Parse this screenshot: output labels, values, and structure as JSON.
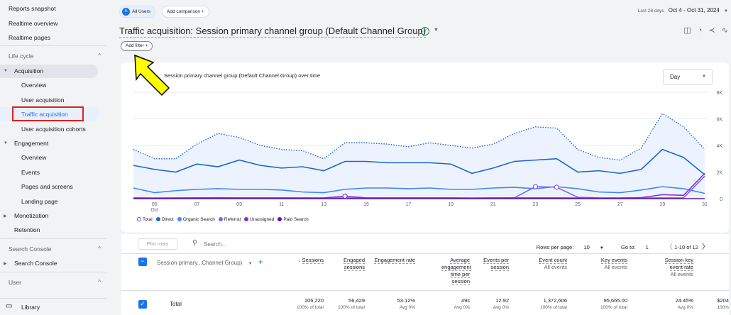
{
  "sidebar": {
    "items": [
      {
        "label": "Reports snapshot"
      },
      {
        "label": "Realtime overview"
      },
      {
        "label": "Realtime pages"
      }
    ],
    "lifecycle": {
      "label": "Life cycle",
      "acquisition": "Acquisition",
      "acquisition_items": [
        "Overview",
        "User acquisition",
        "Traffic acquisition",
        "User acquisition cohorts"
      ],
      "engagement": "Engagement",
      "engagement_items": [
        "Overview",
        "Events",
        "Pages and screens",
        "Landing page"
      ],
      "monetization": "Monetization",
      "retention": "Retention"
    },
    "search_console": {
      "label": "Search Console",
      "item": "Search Console"
    },
    "user": {
      "label": "User"
    },
    "library": "Library"
  },
  "topbar": {
    "all_users_badge": "A",
    "all_users": "All Users",
    "add_comparison": "Add comparison",
    "date_prefix": "Last 28 days",
    "date_range": "Oct 4 - Oct 31, 2024"
  },
  "title": "Traffic acquisition: Session primary channel group (Default Channel Group)",
  "add_filter": "Add filter",
  "chart": {
    "subtitle": "Session primary channel group (Default Channel Group) over time",
    "granularity": "Day",
    "legend": [
      {
        "name": "Total",
        "color": "#ffffff"
      },
      {
        "name": "Direct",
        "color": "#1967d2"
      },
      {
        "name": "Organic Search",
        "color": "#4285f4"
      },
      {
        "name": "Referral",
        "color": "#7b61ff"
      },
      {
        "name": "Unassigned",
        "color": "#8430ce"
      },
      {
        "name": "Paid Search",
        "color": "#5e129e"
      }
    ]
  },
  "chart_data": {
    "type": "line",
    "title": "Session primary channel group (Default Channel Group) over time",
    "x": [
      "04",
      "05",
      "06",
      "07",
      "08",
      "09",
      "10",
      "11",
      "12",
      "13",
      "14",
      "15",
      "16",
      "17",
      "18",
      "19",
      "20",
      "21",
      "22",
      "23",
      "24",
      "25",
      "26",
      "27",
      "28",
      "29",
      "30",
      "31"
    ],
    "x_tick_labels": [
      "05",
      "07",
      "09",
      "11",
      "13",
      "15",
      "17",
      "19",
      "21",
      "23",
      "25",
      "27",
      "29",
      "31"
    ],
    "x_month_label": "Oct",
    "ylim": [
      0,
      8000
    ],
    "y_tick_labels": [
      "0",
      "2K",
      "4K",
      "6K",
      "8K"
    ],
    "grid": true,
    "series": [
      {
        "name": "Total",
        "style": "dotted",
        "values": [
          3700,
          3000,
          3000,
          4100,
          4900,
          4600,
          4000,
          3700,
          3600,
          3000,
          4200,
          4200,
          4100,
          3900,
          4200,
          4000,
          3800,
          4100,
          4900,
          5400,
          5300,
          3700,
          3100,
          2900,
          3800,
          6400,
          5400,
          3700
        ]
      },
      {
        "name": "Direct",
        "values": [
          2500,
          2200,
          2000,
          2600,
          2400,
          2900,
          2500,
          2300,
          2400,
          2100,
          2800,
          2800,
          2700,
          2700,
          2700,
          2600,
          1900,
          2300,
          2800,
          2900,
          3000,
          2000,
          2100,
          1900,
          2200,
          3700,
          3100,
          1800
        ]
      },
      {
        "name": "Organic Search",
        "values": [
          800,
          450,
          600,
          700,
          750,
          700,
          700,
          650,
          500,
          450,
          700,
          800,
          800,
          750,
          800,
          700,
          700,
          800,
          850,
          750,
          900,
          750,
          500,
          450,
          650,
          900,
          750,
          400
        ]
      },
      {
        "name": "Referral",
        "values": [
          60,
          50,
          50,
          60,
          70,
          60,
          60,
          60,
          50,
          50,
          60,
          60,
          60,
          60,
          60,
          60,
          50,
          60,
          60,
          900,
          860,
          100,
          60,
          60,
          60,
          60,
          60,
          1700
        ]
      },
      {
        "name": "Unassigned",
        "values": [
          50,
          40,
          50,
          60,
          60,
          50,
          50,
          50,
          50,
          60,
          180,
          60,
          50,
          50,
          50,
          50,
          40,
          50,
          60,
          60,
          60,
          50,
          40,
          40,
          80,
          300,
          250,
          1900
        ]
      },
      {
        "name": "Paid Search",
        "values": [
          0,
          0,
          0,
          0,
          0,
          0,
          0,
          0,
          0,
          0,
          0,
          0,
          0,
          0,
          0,
          0,
          0,
          0,
          0,
          0,
          0,
          0,
          0,
          0,
          0,
          0,
          0,
          0
        ]
      }
    ]
  },
  "table": {
    "plot_rows": "Plot rows",
    "search_placeholder": "Search...",
    "rows_per_page_label": "Rows per page:",
    "rows_per_page": "10",
    "goto_label": "Go to:",
    "goto_value": "1",
    "range": "1-10 of 12",
    "dimension_header": "Session primary...Channel Group)",
    "columns": [
      {
        "label": "Sessions",
        "sub": "",
        "total": "106,220",
        "total_sub": "100% of total"
      },
      {
        "label": "Engaged sessions",
        "sub": "",
        "total": "56,429",
        "total_sub": "100% of total"
      },
      {
        "label": "Engagement rate",
        "sub": "",
        "total": "53.12%",
        "total_sub": "Avg 0%"
      },
      {
        "label": "Average engagement time per session",
        "sub": "",
        "total": "49s",
        "total_sub": "Avg 0%"
      },
      {
        "label": "Events per session",
        "sub": "",
        "total": "12.92",
        "total_sub": "Avg 0%"
      },
      {
        "label": "Event count",
        "sub": "All events",
        "total": "1,372,606",
        "total_sub": "100% of total"
      },
      {
        "label": "Key events",
        "sub": "All events",
        "total": "95,665.00",
        "total_sub": "100% of total"
      },
      {
        "label": "Session key event rate",
        "sub": "All events",
        "total": "24.45%",
        "total_sub": "Avg 0%"
      },
      {
        "label": "",
        "sub": "",
        "total": "$204",
        "total_sub": "100%"
      }
    ],
    "total_label": "Total"
  }
}
